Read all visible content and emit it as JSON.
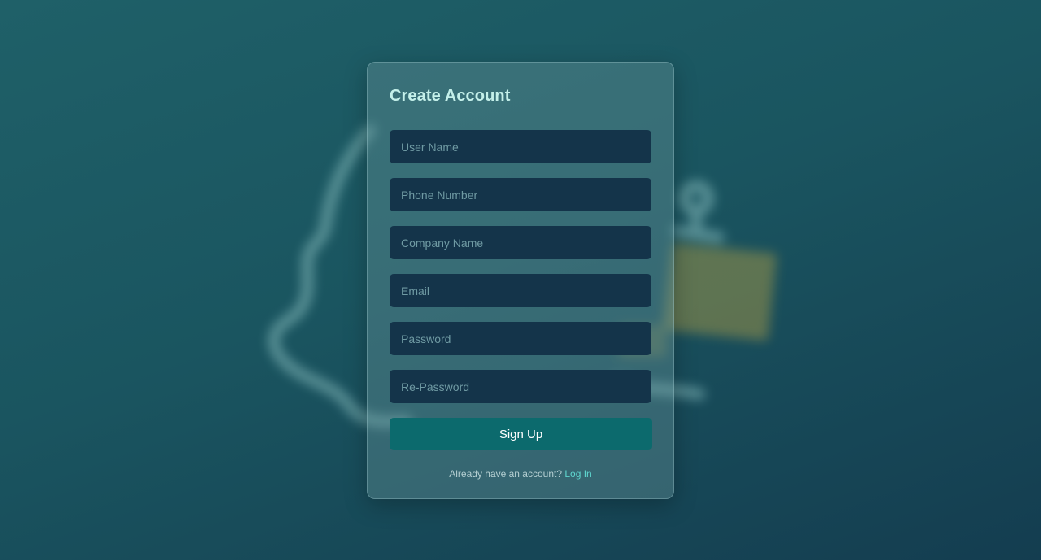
{
  "form": {
    "title": "Create Account",
    "fields": [
      {
        "placeholder": "User Name",
        "value": ""
      },
      {
        "placeholder": "Phone Number",
        "value": ""
      },
      {
        "placeholder": "Company Name",
        "value": ""
      },
      {
        "placeholder": "Email",
        "value": ""
      },
      {
        "placeholder": "Password",
        "value": ""
      },
      {
        "placeholder": "Re-Password",
        "value": ""
      }
    ],
    "submit_label": "Sign Up",
    "footer_text": "Already have an account?",
    "login_link": "Log In"
  },
  "colors": {
    "accent": "#0c6a6d",
    "link": "#5fd6cf",
    "title": "#c4f0ea",
    "input_bg": "#14344a"
  }
}
